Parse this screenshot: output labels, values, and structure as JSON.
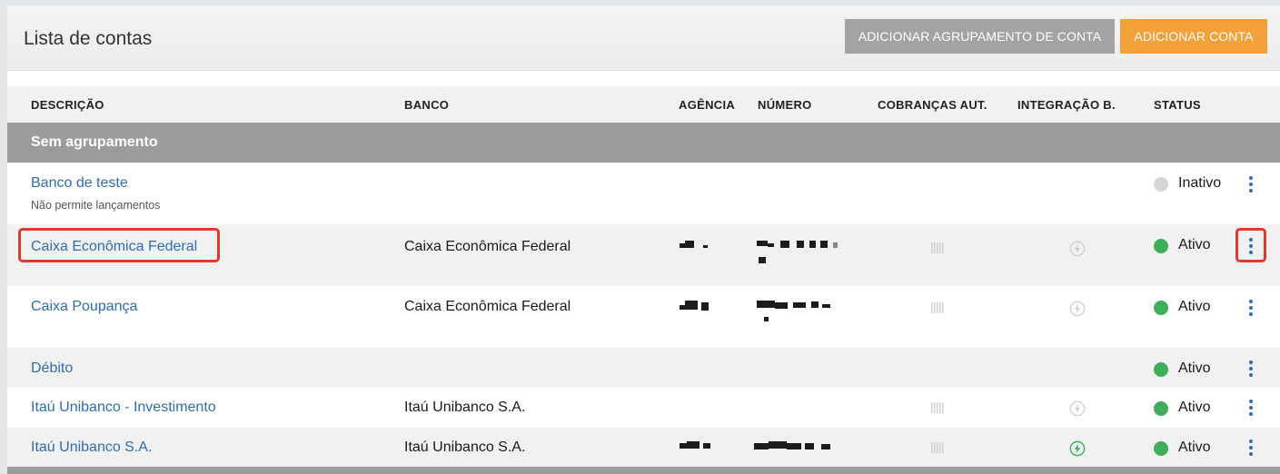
{
  "header": {
    "title": "Lista de contas",
    "btn_add_group": "ADICIONAR AGRUPAMENTO DE CONTA",
    "btn_add_account": "ADICIONAR CONTA"
  },
  "columns": {
    "descricao": "DESCRIÇÃO",
    "banco": "BANCO",
    "agencia": "AGÊNCIA",
    "numero": "NÚMERO",
    "cobrancas": "COBRANÇAS AUT.",
    "integracao": "INTEGRAÇÃO B.",
    "status": "STATUS"
  },
  "group": {
    "label": "Sem agrupamento"
  },
  "rows": [
    {
      "descricao": "Banco de teste",
      "sub": "Não permite lançamentos",
      "banco": "",
      "status": "Inativo",
      "status_color": "#d6d6d6"
    },
    {
      "descricao": "Caixa Econômica Federal",
      "banco": "Caixa Econômica Federal",
      "status": "Ativo",
      "status_color": "#3fae5a"
    },
    {
      "descricao": "Caixa Poupança",
      "banco": "Caixa Econômica Federal",
      "status": "Ativo",
      "status_color": "#3fae5a"
    },
    {
      "descricao": "Débito",
      "banco": "",
      "status": "Ativo",
      "status_color": "#3fae5a"
    },
    {
      "descricao": "Itaú Unibanco - Investimento",
      "banco": "Itaú Unibanco S.A.",
      "status": "Ativo",
      "status_color": "#3fae5a"
    },
    {
      "descricao": "Itaú Unibanco S.A.",
      "banco": "Itaú Unibanco S.A.",
      "status": "Ativo",
      "status_color": "#3fae5a"
    }
  ],
  "colors": {
    "link": "#2f6db0",
    "orange": "#f5a13a",
    "grey_button": "#a3a3a3",
    "group_bar": "#9c9c9c",
    "active": "#3fae5a",
    "inactive": "#d6d6d6",
    "highlight": "#e03a2f",
    "integration_active": "#3fae5a",
    "integration_inactive": "#cfcfcf"
  },
  "icons": {
    "kebab": "kebab-menu-icon",
    "barcode": "barcode-icon",
    "integration": "lightning-bolt-icon",
    "status": "status-dot-icon"
  }
}
